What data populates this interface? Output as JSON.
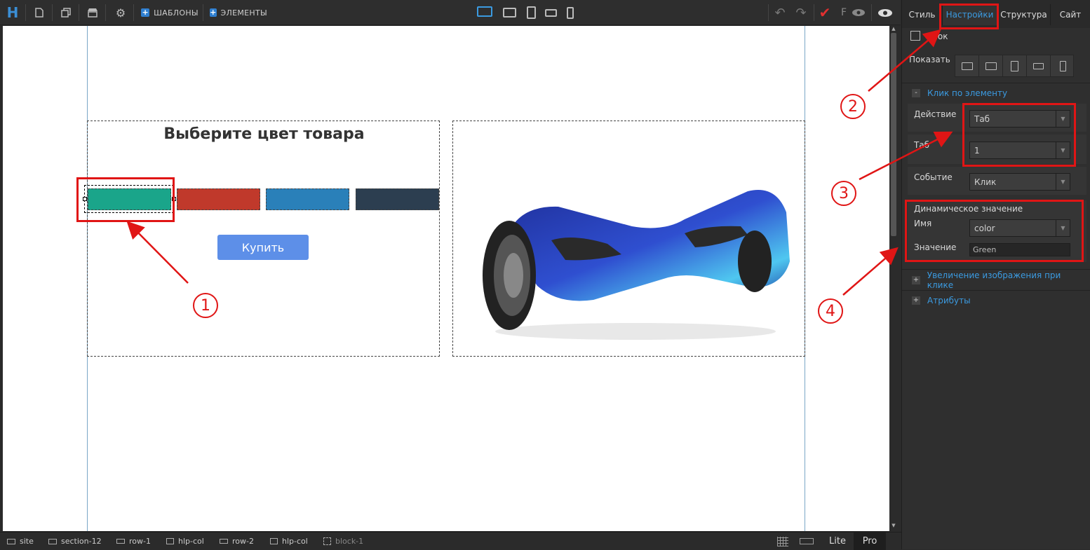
{
  "toolbar": {
    "logo": "H",
    "templates_label": "ШАБЛОНЫ",
    "elements_label": "ЭЛЕМЕНТЫ",
    "f_label": "F"
  },
  "canvas": {
    "heading": "Выберите цвет товара",
    "swatches": [
      {
        "name": "green",
        "color": "#1aa58a"
      },
      {
        "name": "red",
        "color": "#c0392b"
      },
      {
        "name": "blue",
        "color": "#2a80b9"
      },
      {
        "name": "dark",
        "color": "#2c3e50"
      }
    ],
    "buy_label": "Купить",
    "product_image": "hoverboard"
  },
  "panel": {
    "tabs": [
      "Стиль",
      "Настройки",
      "Структура",
      "Сайт"
    ],
    "active_tab": "Настройки",
    "block_label": "Блок",
    "show_label": "Показать",
    "click_section": {
      "sign": "-",
      "title": "Клик по элементу",
      "action_label": "Действие",
      "action_value": "Таб",
      "tab_label": "Таб",
      "tab_value": "1",
      "event_label": "Событие",
      "event_value": "Клик"
    },
    "dynamic": {
      "title": "Динамическое значение",
      "name_label": "Имя",
      "name_value": "color",
      "value_label": "Значение",
      "value_placeholder": "Green"
    },
    "zoom_section": {
      "sign": "+",
      "title": "Увеличение изображения при клике"
    },
    "attrs_section": {
      "sign": "+",
      "title": "Атрибуты"
    }
  },
  "statusbar": {
    "crumbs": [
      "site",
      "section-12",
      "row-1",
      "hlp-col",
      "row-2",
      "hlp-col",
      "block-1"
    ],
    "lite_label": "Lite",
    "pro_label": "Pro"
  },
  "annotations": [
    "1",
    "2",
    "3",
    "4"
  ],
  "colors": {
    "accent": "#3b9ae0",
    "annotation": "#e01515",
    "buy_button": "#5d8fe8"
  }
}
